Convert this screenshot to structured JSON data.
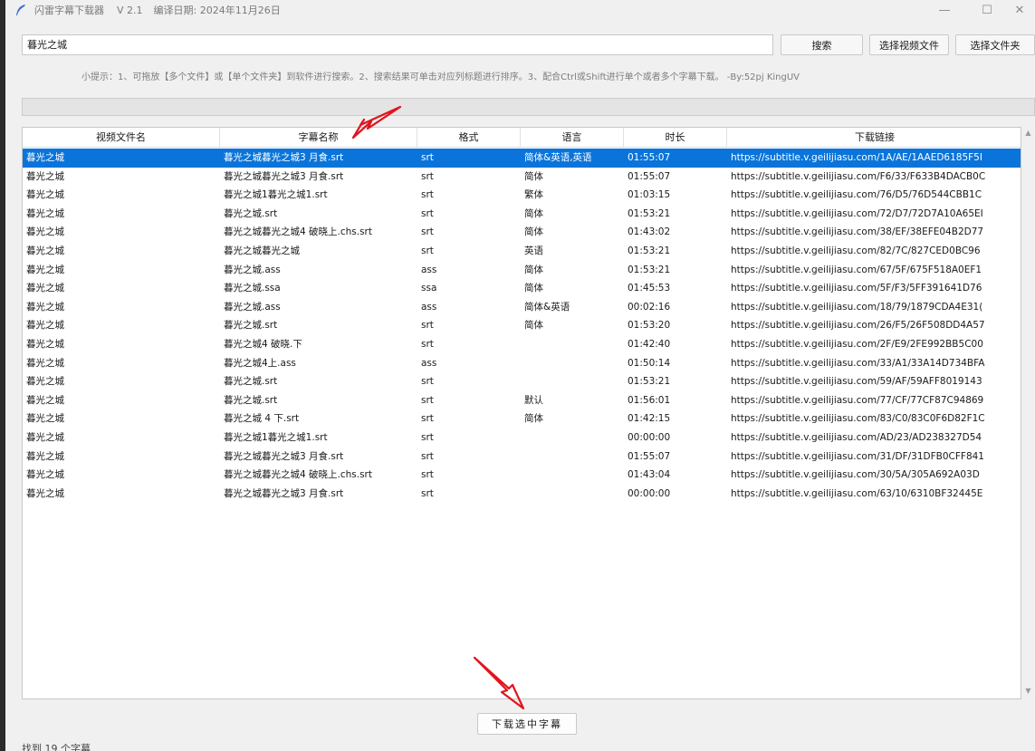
{
  "window": {
    "title": "闪雷字幕下载器",
    "version": "V 2.1",
    "build_date": "编译日期: 2024年11月26日",
    "minimize": "—",
    "maximize": "☐",
    "close": "✕"
  },
  "toolbar": {
    "search_value": "暮光之城",
    "search_label": "搜索",
    "select_video_label": "选择视频文件",
    "select_folder_label": "选择文件夹"
  },
  "hint": "小提示：1、可拖放【多个文件】或【单个文件夹】到软件进行搜索。2、搜索结果可单击对应列标题进行排序。3、配合Ctrl或Shift进行单个或者多个字幕下载。 -By:52pj KingUV",
  "table": {
    "columns": [
      "视频文件名",
      "字幕名称",
      "格式",
      "语言",
      "时长",
      "下载链接"
    ],
    "rows": [
      [
        "暮光之城",
        "暮光之城暮光之城3 月食.srt",
        "srt",
        "简体&英语,英语",
        "01:55:07",
        "https://subtitle.v.geilijiasu.com/1A/AE/1AAED6185F5I"
      ],
      [
        "暮光之城",
        "暮光之城暮光之城3 月食.srt",
        "srt",
        "简体",
        "01:55:07",
        "https://subtitle.v.geilijiasu.com/F6/33/F633B4DACB0C"
      ],
      [
        "暮光之城",
        "暮光之城1暮光之城1.srt",
        "srt",
        "繁体",
        "01:03:15",
        "https://subtitle.v.geilijiasu.com/76/D5/76D544CBB1C"
      ],
      [
        "暮光之城",
        "暮光之城.srt",
        "srt",
        "简体",
        "01:53:21",
        "https://subtitle.v.geilijiasu.com/72/D7/72D7A10A65EI"
      ],
      [
        "暮光之城",
        "暮光之城暮光之城4 破晓上.chs.srt",
        "srt",
        "简体",
        "01:43:02",
        "https://subtitle.v.geilijiasu.com/38/EF/38EFE04B2D77"
      ],
      [
        "暮光之城",
        "暮光之城暮光之城",
        "srt",
        "英语",
        "01:53:21",
        "https://subtitle.v.geilijiasu.com/82/7C/827CED0BC96"
      ],
      [
        "暮光之城",
        "暮光之城.ass",
        "ass",
        "简体",
        "01:53:21",
        "https://subtitle.v.geilijiasu.com/67/5F/675F518A0EF1"
      ],
      [
        "暮光之城",
        "暮光之城.ssa",
        "ssa",
        "简体",
        "01:45:53",
        "https://subtitle.v.geilijiasu.com/5F/F3/5FF391641D76"
      ],
      [
        "暮光之城",
        "暮光之城.ass",
        "ass",
        "简体&英语",
        "00:02:16",
        "https://subtitle.v.geilijiasu.com/18/79/1879CDA4E31("
      ],
      [
        "暮光之城",
        "暮光之城.srt",
        "srt",
        "简体",
        "01:53:20",
        "https://subtitle.v.geilijiasu.com/26/F5/26F508DD4A57"
      ],
      [
        "暮光之城",
        "暮光之城4 破晓.下",
        "srt",
        "",
        "01:42:40",
        "https://subtitle.v.geilijiasu.com/2F/E9/2FE992BB5C00"
      ],
      [
        "暮光之城",
        "暮光之城4上.ass",
        "ass",
        "",
        "01:50:14",
        "https://subtitle.v.geilijiasu.com/33/A1/33A14D734BFA"
      ],
      [
        "暮光之城",
        "暮光之城.srt",
        "srt",
        "",
        "01:53:21",
        "https://subtitle.v.geilijiasu.com/59/AF/59AFF8019143"
      ],
      [
        "暮光之城",
        "暮光之城.srt",
        "srt",
        "默认",
        "01:56:01",
        "https://subtitle.v.geilijiasu.com/77/CF/77CF87C94869"
      ],
      [
        "暮光之城",
        "暮光之城 4 下.srt",
        "srt",
        "简体",
        "01:42:15",
        "https://subtitle.v.geilijiasu.com/83/C0/83C0F6D82F1C"
      ],
      [
        "暮光之城",
        "暮光之城1暮光之城1.srt",
        "srt",
        "",
        "00:00:00",
        "https://subtitle.v.geilijiasu.com/AD/23/AD238327D54"
      ],
      [
        "暮光之城",
        "暮光之城暮光之城3 月食.srt",
        "srt",
        "",
        "01:55:07",
        "https://subtitle.v.geilijiasu.com/31/DF/31DFB0CFF841"
      ],
      [
        "暮光之城",
        "暮光之城暮光之城4 破晓上.chs.srt",
        "srt",
        "",
        "01:43:04",
        "https://subtitle.v.geilijiasu.com/30/5A/305A692A03D"
      ],
      [
        "暮光之城",
        "暮光之城暮光之城3 月食.srt",
        "srt",
        "",
        "00:00:00",
        "https://subtitle.v.geilijiasu.com/63/10/6310BF32445E"
      ]
    ],
    "selected_row": 0
  },
  "download_label": "下载选中字幕",
  "status": "找到 19 个字幕",
  "colors": {
    "selected_row": "#0a74da",
    "annotation_arrow": "#e0141e"
  },
  "icons": {
    "app": "feather-icon",
    "scroll_up": "scroll-up-icon",
    "scroll_down": "scroll-down-icon"
  }
}
